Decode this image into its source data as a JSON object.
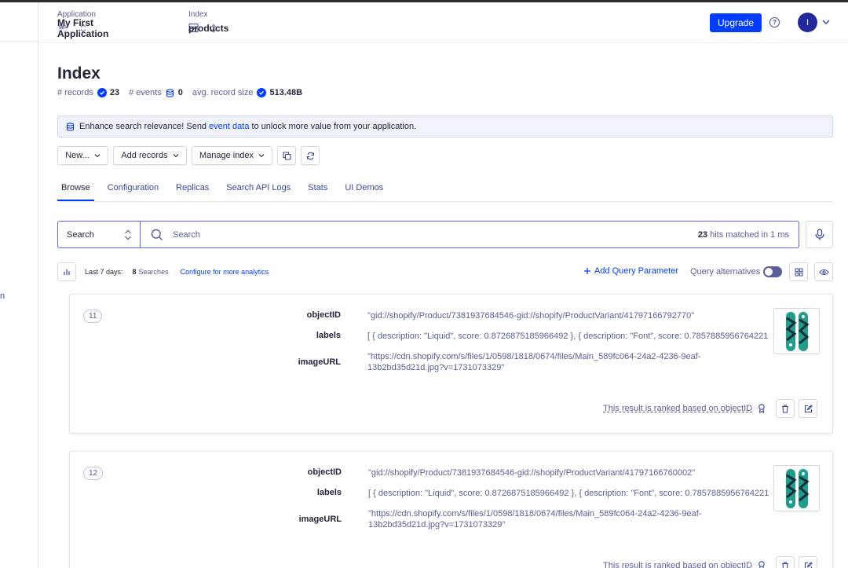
{
  "left_edge_fragment": "n",
  "topbar": {
    "application": {
      "label": "Application",
      "badge": "MF",
      "value": "My First Application"
    },
    "index": {
      "label": "Index",
      "value": "products"
    },
    "upgrade_label": "Upgrade",
    "avatar_initial": "I"
  },
  "page": {
    "title": "Index",
    "stats": [
      {
        "key": "# records",
        "value": "23"
      },
      {
        "key": "# events",
        "value": "0"
      },
      {
        "key": "avg. record size",
        "value": "513.48B"
      }
    ]
  },
  "banner": {
    "text_before": "Enhance search relevance! Send",
    "link": "event data",
    "text_after": "to unlock more value from your application."
  },
  "toolbar": {
    "new_label": "New...",
    "add_records_label": "Add records",
    "manage_index_label": "Manage index"
  },
  "tabs": [
    "Browse",
    "Configuration",
    "Replicas",
    "Search API Logs",
    "Stats",
    "UI Demos"
  ],
  "search": {
    "mode": "Search",
    "placeholder": "Search",
    "hits_count": "23",
    "hits_text": "hits matched in 1 ms"
  },
  "analytics": {
    "period": "Last 7 days:",
    "count": "8",
    "count_label": "Searches",
    "separator": "·",
    "configure_link": "Configure for more analytics",
    "add_query_param": "Add Query Parameter",
    "query_alternatives": "Query alternatives"
  },
  "results": [
    {
      "position": "11",
      "objectID_key": "objectID",
      "objectID": "\"gid://shopify/Product/7381937684546-gid://shopify/ProductVariant/41797166792770\"",
      "labels_key": "labels",
      "labels": "[ { description: \"Liquid\", score: 0.8726875185966492 }, { description: \"Font\", score: 0.7857885956764221",
      "imageURL_key": "imageURL",
      "imageURL_line1": "\"https://cdn.shopify.com/s/files/1/0598/1818/0674/files/Main_589fc064-24a2-4236-9eaf-",
      "imageURL_line2": "13b2bd35d21d.jpg?v=1731073329\"",
      "rank_note": "This result is ranked based on objectID"
    },
    {
      "position": "12",
      "objectID_key": "objectID",
      "objectID": "\"gid://shopify/Product/7381937684546-gid://shopify/ProductVariant/41797166760002\"",
      "labels_key": "labels",
      "labels": "[ { description: \"Liquid\", score: 0.8726875185966492 }, { description: \"Font\", score: 0.7857885956764221",
      "imageURL_key": "imageURL",
      "imageURL_line1": "\"https://cdn.shopify.com/s/files/1/0598/1818/0674/files/Main_589fc064-24a2-4236-9eaf-",
      "imageURL_line2": "13b2bd35d21d.jpg?v=1731073329\"",
      "rank_note": "This result is ranked based on objectID"
    }
  ],
  "colors": {
    "primary": "#003dff",
    "text": "#23263b",
    "muted": "#5a5e9a",
    "border": "#d6d6e7"
  }
}
